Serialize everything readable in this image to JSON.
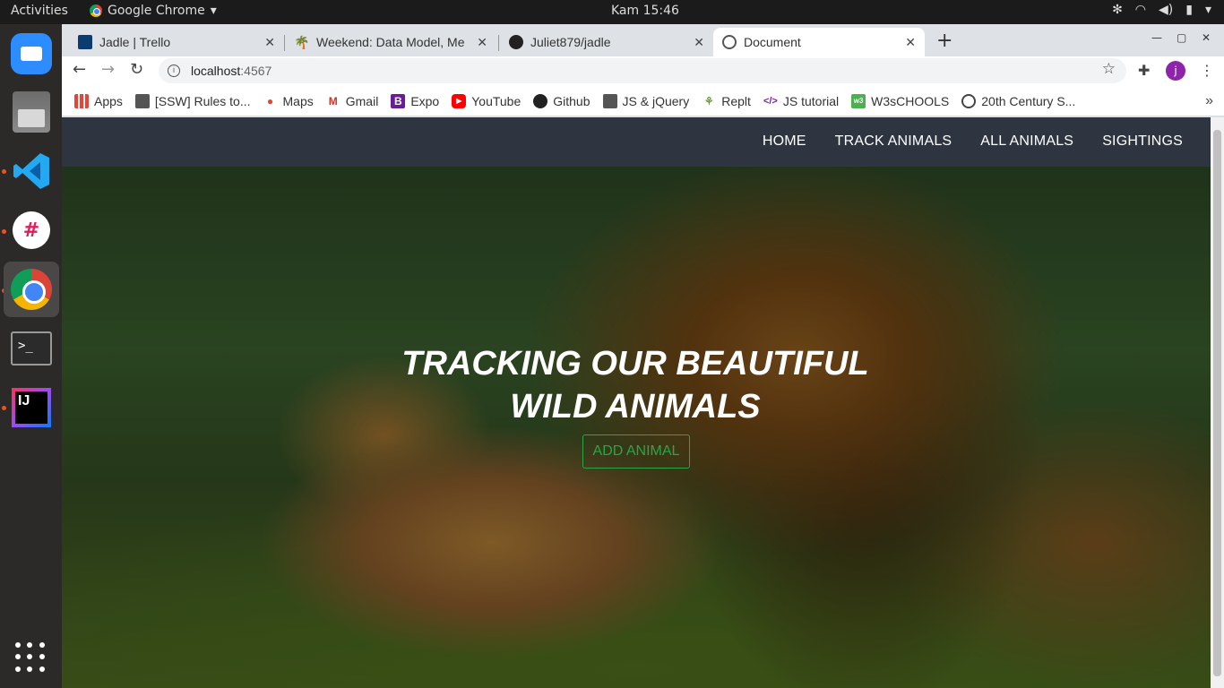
{
  "os": {
    "activities": "Activities",
    "app_menu": "Google Chrome",
    "clock": "Kam 15:46"
  },
  "dock": {
    "apps": [
      "zoom-icon",
      "files-icon",
      "vscode-icon",
      "slack-icon",
      "chrome-icon",
      "terminal-icon",
      "intellij-icon",
      "show-apps-icon"
    ]
  },
  "browser": {
    "tabs": [
      {
        "title": "Jadle | Trello",
        "active": false
      },
      {
        "title": "Weekend: Data Model, Me",
        "active": false
      },
      {
        "title": "Juliet879/jadle",
        "active": false
      },
      {
        "title": "Document",
        "active": true
      }
    ],
    "url_host": "localhost",
    "url_port": ":4567",
    "profile_initial": "j",
    "bookmarks": [
      {
        "label": "Apps",
        "icon": "apps-grid-icon"
      },
      {
        "label": "[SSW] Rules to...",
        "icon": "ssw-icon"
      },
      {
        "label": "Maps",
        "icon": "maps-icon"
      },
      {
        "label": "Gmail",
        "icon": "gmail-icon"
      },
      {
        "label": "Expo",
        "icon": "expo-icon"
      },
      {
        "label": "YouTube",
        "icon": "youtube-icon"
      },
      {
        "label": "Github",
        "icon": "github-icon"
      },
      {
        "label": "JS & jQuery",
        "icon": "jsjquery-icon"
      },
      {
        "label": "Replt",
        "icon": "replit-icon"
      },
      {
        "label": "JS tutorial",
        "icon": "code-icon"
      },
      {
        "label": "W3sCHOOLS",
        "icon": "w3schools-icon"
      },
      {
        "label": "20th Century S...",
        "icon": "globe-icon"
      }
    ]
  },
  "page": {
    "nav": [
      "HOME",
      "TRACK ANIMALS",
      "ALL ANIMALS",
      "SIGHTINGS"
    ],
    "hero_title": "TRACKING OUR BEAUTIFUL WILD ANIMALS",
    "cta_label": "ADD ANIMAL"
  },
  "colors": {
    "navbar_bg": "#2e3540",
    "cta": "#28a745"
  }
}
